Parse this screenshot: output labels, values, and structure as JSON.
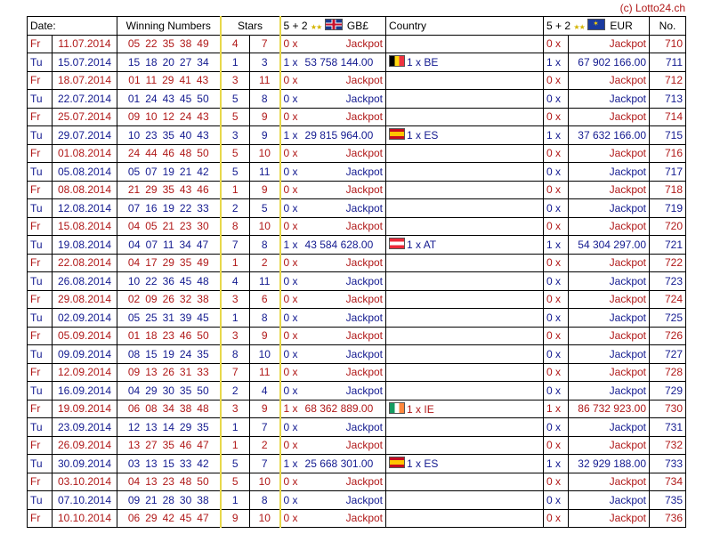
{
  "copyright": "(c) Lotto24.ch",
  "headers": {
    "date": "Date:",
    "numbers": "Winning Numbers",
    "stars": "Stars",
    "gbp": "5 + 2",
    "gbp_currency": "GB£",
    "country": "Country",
    "eur": "5 + 2",
    "eur_currency": "EUR",
    "no": "No."
  },
  "colors": {
    "red": "#b01818",
    "blue": "#12198f",
    "stars_border": "#e8d84a"
  },
  "rows": [
    {
      "day": "Fr",
      "date": "11.07.2014",
      "numbers": [
        "05",
        "22",
        "35",
        "38",
        "49"
      ],
      "stars": [
        "4",
        "7"
      ],
      "gbp_count": "0 x",
      "gbp_amount": "Jackpot",
      "country_flag": "",
      "country_text": "",
      "eur_count": "0 x",
      "eur_amount": "Jackpot",
      "no": "710"
    },
    {
      "day": "Tu",
      "date": "15.07.2014",
      "numbers": [
        "15",
        "18",
        "20",
        "27",
        "34"
      ],
      "stars": [
        "1",
        "3"
      ],
      "gbp_count": "1 x",
      "gbp_amount": "53 758 144.00",
      "country_flag": "be",
      "country_text": "1 x BE",
      "eur_count": "1 x",
      "eur_amount": "67 902 166.00",
      "no": "711"
    },
    {
      "day": "Fr",
      "date": "18.07.2014",
      "numbers": [
        "01",
        "11",
        "29",
        "41",
        "43"
      ],
      "stars": [
        "3",
        "11"
      ],
      "gbp_count": "0 x",
      "gbp_amount": "Jackpot",
      "country_flag": "",
      "country_text": "",
      "eur_count": "0 x",
      "eur_amount": "Jackpot",
      "no": "712"
    },
    {
      "day": "Tu",
      "date": "22.07.2014",
      "numbers": [
        "01",
        "24",
        "43",
        "45",
        "50"
      ],
      "stars": [
        "5",
        "8"
      ],
      "gbp_count": "0 x",
      "gbp_amount": "Jackpot",
      "country_flag": "",
      "country_text": "",
      "eur_count": "0 x",
      "eur_amount": "Jackpot",
      "no": "713"
    },
    {
      "day": "Fr",
      "date": "25.07.2014",
      "numbers": [
        "09",
        "10",
        "12",
        "24",
        "43"
      ],
      "stars": [
        "5",
        "9"
      ],
      "gbp_count": "0 x",
      "gbp_amount": "Jackpot",
      "country_flag": "",
      "country_text": "",
      "eur_count": "0 x",
      "eur_amount": "Jackpot",
      "no": "714"
    },
    {
      "day": "Tu",
      "date": "29.07.2014",
      "numbers": [
        "10",
        "23",
        "35",
        "40",
        "43"
      ],
      "stars": [
        "3",
        "9"
      ],
      "gbp_count": "1 x",
      "gbp_amount": "29 815 964.00",
      "country_flag": "es",
      "country_text": "1 x ES",
      "eur_count": "1 x",
      "eur_amount": "37 632 166.00",
      "no": "715"
    },
    {
      "day": "Fr",
      "date": "01.08.2014",
      "numbers": [
        "24",
        "44",
        "46",
        "48",
        "50"
      ],
      "stars": [
        "5",
        "10"
      ],
      "gbp_count": "0 x",
      "gbp_amount": "Jackpot",
      "country_flag": "",
      "country_text": "",
      "eur_count": "0 x",
      "eur_amount": "Jackpot",
      "no": "716"
    },
    {
      "day": "Tu",
      "date": "05.08.2014",
      "numbers": [
        "05",
        "07",
        "19",
        "21",
        "42"
      ],
      "stars": [
        "5",
        "11"
      ],
      "gbp_count": "0 x",
      "gbp_amount": "Jackpot",
      "country_flag": "",
      "country_text": "",
      "eur_count": "0 x",
      "eur_amount": "Jackpot",
      "no": "717"
    },
    {
      "day": "Fr",
      "date": "08.08.2014",
      "numbers": [
        "21",
        "29",
        "35",
        "43",
        "46"
      ],
      "stars": [
        "1",
        "9"
      ],
      "gbp_count": "0 x",
      "gbp_amount": "Jackpot",
      "country_flag": "",
      "country_text": "",
      "eur_count": "0 x",
      "eur_amount": "Jackpot",
      "no": "718"
    },
    {
      "day": "Tu",
      "date": "12.08.2014",
      "numbers": [
        "07",
        "16",
        "19",
        "22",
        "33"
      ],
      "stars": [
        "2",
        "5"
      ],
      "gbp_count": "0 x",
      "gbp_amount": "Jackpot",
      "country_flag": "",
      "country_text": "",
      "eur_count": "0 x",
      "eur_amount": "Jackpot",
      "no": "719"
    },
    {
      "day": "Fr",
      "date": "15.08.2014",
      "numbers": [
        "04",
        "05",
        "21",
        "23",
        "30"
      ],
      "stars": [
        "8",
        "10"
      ],
      "gbp_count": "0 x",
      "gbp_amount": "Jackpot",
      "country_flag": "",
      "country_text": "",
      "eur_count": "0 x",
      "eur_amount": "Jackpot",
      "no": "720"
    },
    {
      "day": "Tu",
      "date": "19.08.2014",
      "numbers": [
        "04",
        "07",
        "11",
        "34",
        "47"
      ],
      "stars": [
        "7",
        "8"
      ],
      "gbp_count": "1 x",
      "gbp_amount": "43 584 628.00",
      "country_flag": "at",
      "country_text": "1 x AT",
      "eur_count": "1 x",
      "eur_amount": "54 304 297.00",
      "no": "721"
    },
    {
      "day": "Fr",
      "date": "22.08.2014",
      "numbers": [
        "04",
        "17",
        "29",
        "35",
        "49"
      ],
      "stars": [
        "1",
        "2"
      ],
      "gbp_count": "0 x",
      "gbp_amount": "Jackpot",
      "country_flag": "",
      "country_text": "",
      "eur_count": "0 x",
      "eur_amount": "Jackpot",
      "no": "722"
    },
    {
      "day": "Tu",
      "date": "26.08.2014",
      "numbers": [
        "10",
        "22",
        "36",
        "45",
        "48"
      ],
      "stars": [
        "4",
        "11"
      ],
      "gbp_count": "0 x",
      "gbp_amount": "Jackpot",
      "country_flag": "",
      "country_text": "",
      "eur_count": "0 x",
      "eur_amount": "Jackpot",
      "no": "723"
    },
    {
      "day": "Fr",
      "date": "29.08.2014",
      "numbers": [
        "02",
        "09",
        "26",
        "32",
        "38"
      ],
      "stars": [
        "3",
        "6"
      ],
      "gbp_count": "0 x",
      "gbp_amount": "Jackpot",
      "country_flag": "",
      "country_text": "",
      "eur_count": "0 x",
      "eur_amount": "Jackpot",
      "no": "724"
    },
    {
      "day": "Tu",
      "date": "02.09.2014",
      "numbers": [
        "05",
        "25",
        "31",
        "39",
        "45"
      ],
      "stars": [
        "1",
        "8"
      ],
      "gbp_count": "0 x",
      "gbp_amount": "Jackpot",
      "country_flag": "",
      "country_text": "",
      "eur_count": "0 x",
      "eur_amount": "Jackpot",
      "no": "725"
    },
    {
      "day": "Fr",
      "date": "05.09.2014",
      "numbers": [
        "01",
        "18",
        "23",
        "46",
        "50"
      ],
      "stars": [
        "3",
        "9"
      ],
      "gbp_count": "0 x",
      "gbp_amount": "Jackpot",
      "country_flag": "",
      "country_text": "",
      "eur_count": "0 x",
      "eur_amount": "Jackpot",
      "no": "726"
    },
    {
      "day": "Tu",
      "date": "09.09.2014",
      "numbers": [
        "08",
        "15",
        "19",
        "24",
        "35"
      ],
      "stars": [
        "8",
        "10"
      ],
      "gbp_count": "0 x",
      "gbp_amount": "Jackpot",
      "country_flag": "",
      "country_text": "",
      "eur_count": "0 x",
      "eur_amount": "Jackpot",
      "no": "727"
    },
    {
      "day": "Fr",
      "date": "12.09.2014",
      "numbers": [
        "09",
        "13",
        "26",
        "31",
        "33"
      ],
      "stars": [
        "7",
        "11"
      ],
      "gbp_count": "0 x",
      "gbp_amount": "Jackpot",
      "country_flag": "",
      "country_text": "",
      "eur_count": "0 x",
      "eur_amount": "Jackpot",
      "no": "728"
    },
    {
      "day": "Tu",
      "date": "16.09.2014",
      "numbers": [
        "04",
        "29",
        "30",
        "35",
        "50"
      ],
      "stars": [
        "2",
        "4"
      ],
      "gbp_count": "0 x",
      "gbp_amount": "Jackpot",
      "country_flag": "",
      "country_text": "",
      "eur_count": "0 x",
      "eur_amount": "Jackpot",
      "no": "729"
    },
    {
      "day": "Fr",
      "date": "19.09.2014",
      "numbers": [
        "06",
        "08",
        "34",
        "38",
        "48"
      ],
      "stars": [
        "3",
        "9"
      ],
      "gbp_count": "1 x",
      "gbp_amount": "68 362 889.00",
      "country_flag": "ie",
      "country_text": "1 x IE",
      "eur_count": "1 x",
      "eur_amount": "86 732 923.00",
      "no": "730"
    },
    {
      "day": "Tu",
      "date": "23.09.2014",
      "numbers": [
        "12",
        "13",
        "14",
        "29",
        "35"
      ],
      "stars": [
        "1",
        "7"
      ],
      "gbp_count": "0 x",
      "gbp_amount": "Jackpot",
      "country_flag": "",
      "country_text": "",
      "eur_count": "0 x",
      "eur_amount": "Jackpot",
      "no": "731"
    },
    {
      "day": "Fr",
      "date": "26.09.2014",
      "numbers": [
        "13",
        "27",
        "35",
        "46",
        "47"
      ],
      "stars": [
        "1",
        "2"
      ],
      "gbp_count": "0 x",
      "gbp_amount": "Jackpot",
      "country_flag": "",
      "country_text": "",
      "eur_count": "0 x",
      "eur_amount": "Jackpot",
      "no": "732"
    },
    {
      "day": "Tu",
      "date": "30.09.2014",
      "numbers": [
        "03",
        "13",
        "15",
        "33",
        "42"
      ],
      "stars": [
        "5",
        "7"
      ],
      "gbp_count": "1 x",
      "gbp_amount": "25 668 301.00",
      "country_flag": "es",
      "country_text": "1 x ES",
      "eur_count": "1 x",
      "eur_amount": "32 929 188.00",
      "no": "733"
    },
    {
      "day": "Fr",
      "date": "03.10.2014",
      "numbers": [
        "04",
        "13",
        "23",
        "48",
        "50"
      ],
      "stars": [
        "5",
        "10"
      ],
      "gbp_count": "0 x",
      "gbp_amount": "Jackpot",
      "country_flag": "",
      "country_text": "",
      "eur_count": "0 x",
      "eur_amount": "Jackpot",
      "no": "734"
    },
    {
      "day": "Tu",
      "date": "07.10.2014",
      "numbers": [
        "09",
        "21",
        "28",
        "30",
        "38"
      ],
      "stars": [
        "1",
        "8"
      ],
      "gbp_count": "0 x",
      "gbp_amount": "Jackpot",
      "country_flag": "",
      "country_text": "",
      "eur_count": "0 x",
      "eur_amount": "Jackpot",
      "no": "735"
    },
    {
      "day": "Fr",
      "date": "10.10.2014",
      "numbers": [
        "06",
        "29",
        "42",
        "45",
        "47"
      ],
      "stars": [
        "9",
        "10"
      ],
      "gbp_count": "0 x",
      "gbp_amount": "Jackpot",
      "country_flag": "",
      "country_text": "",
      "eur_count": "0 x",
      "eur_amount": "Jackpot",
      "no": "736"
    }
  ]
}
